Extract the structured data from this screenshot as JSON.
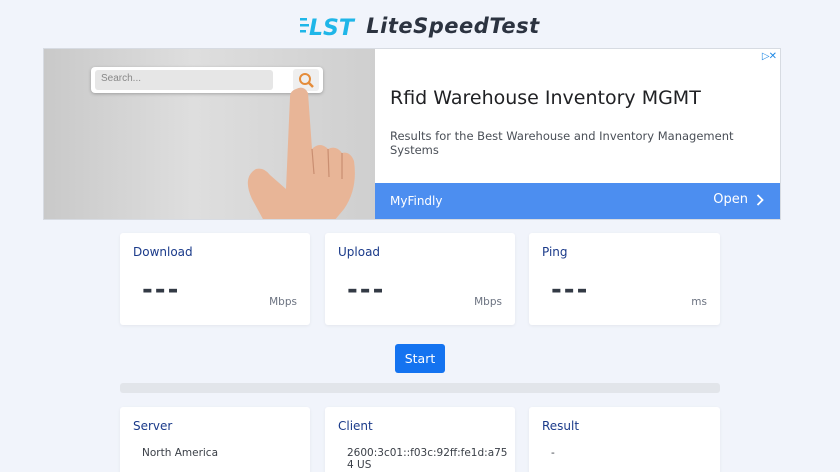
{
  "header": {
    "logo_mark": "LST",
    "logo_name": "LiteSpeedTest"
  },
  "ad": {
    "search_placeholder": "Search...",
    "title": "Rfid Warehouse Inventory MGMT",
    "description": "Results for the Best Warehouse and Inventory Management Systems",
    "advertiser": "MyFindly",
    "cta": "Open",
    "bar_color": "#4c8ef0"
  },
  "metrics": {
    "download": {
      "label": "Download",
      "value": "---",
      "unit": "Mbps"
    },
    "upload": {
      "label": "Upload",
      "value": "---",
      "unit": "Mbps"
    },
    "ping": {
      "label": "Ping",
      "value": "---",
      "unit": "ms"
    }
  },
  "controls": {
    "start_label": "Start",
    "accent": "#1473f0",
    "progress": 0
  },
  "info": {
    "server": {
      "label": "Server",
      "value": "North America"
    },
    "client": {
      "label": "Client",
      "value": "2600:3c01::f03c:92ff:fe1d:a754 US"
    },
    "result": {
      "label": "Result",
      "value": "-"
    }
  }
}
